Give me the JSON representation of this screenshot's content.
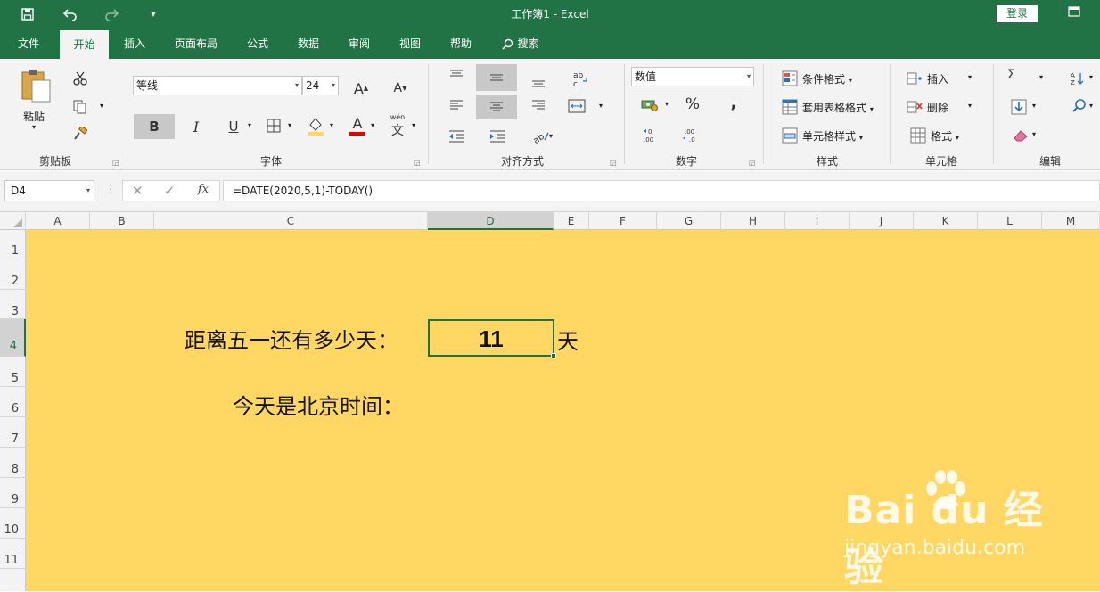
{
  "window": {
    "title": "工作簿1 - Excel",
    "login_label": "登录"
  },
  "quick_access": {
    "save_icon": "save-icon",
    "undo_icon": "undo-icon",
    "redo_icon": "redo-icon",
    "customize_icon": "customize-icon"
  },
  "tabs": [
    {
      "label": "文件",
      "active": false
    },
    {
      "label": "开始",
      "active": true
    },
    {
      "label": "插入",
      "active": false
    },
    {
      "label": "页面布局",
      "active": false
    },
    {
      "label": "公式",
      "active": false
    },
    {
      "label": "数据",
      "active": false
    },
    {
      "label": "审阅",
      "active": false
    },
    {
      "label": "视图",
      "active": false
    },
    {
      "label": "帮助",
      "active": false
    }
  ],
  "search_label": "搜索",
  "ribbon": {
    "clipboard": {
      "label": "剪贴板",
      "paste_label": "粘贴"
    },
    "font": {
      "label": "字体",
      "font_name": "等线",
      "font_size": "24",
      "bold": "B",
      "italic": "I",
      "underline": "U",
      "grow": "A",
      "shrink": "A",
      "font_color_glyph": "A",
      "phonetic_glyph": "文"
    },
    "alignment": {
      "label": "对齐方式"
    },
    "number": {
      "label": "数字",
      "format": "数值",
      "percent": "%",
      "comma": ","
    },
    "styles": {
      "label": "样式",
      "conditional": "条件格式",
      "table": "套用表格格式",
      "cell_styles": "单元格样式"
    },
    "cells": {
      "label": "单元格",
      "insert": "插入",
      "delete": "删除",
      "format": "格式"
    },
    "editing": {
      "label": "编辑",
      "sum": "Σ"
    }
  },
  "formula_bar": {
    "name_box": "D4",
    "fx": "fx",
    "formula": "=DATE(2020,5,1)-TODAY()"
  },
  "columns": [
    "A",
    "B",
    "C",
    "D",
    "E",
    "F",
    "G",
    "H",
    "I",
    "J",
    "K",
    "L",
    "M"
  ],
  "rows": [
    "1",
    "2",
    "3",
    "4",
    "5",
    "6",
    "7",
    "8",
    "9",
    "10",
    "11"
  ],
  "selected": {
    "column": "D",
    "row": "4"
  },
  "cells": {
    "C4": "距离五一还有多少天：",
    "D4": "11",
    "E4": "天",
    "C6": "今天是北京时间："
  },
  "colors": {
    "excel_green": "#217346",
    "sheet_fill": "#ffd762"
  },
  "watermark": {
    "logo_text": "Bai du 经验",
    "url_text": "jingyan.baidu.com"
  }
}
